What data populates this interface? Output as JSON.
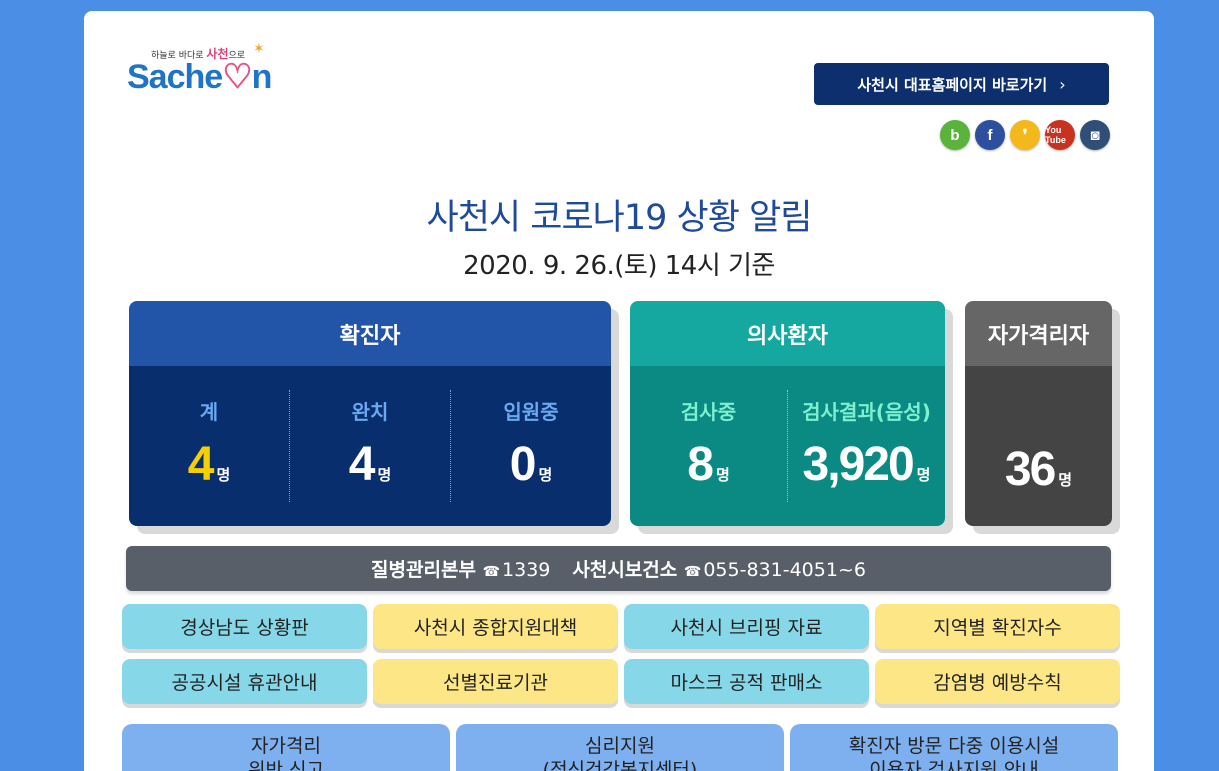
{
  "logo": {
    "tagline_prefix": "하늘로 바다로",
    "tagline_mid": "사천",
    "tagline_suffix": "으로",
    "word_a": "Sache",
    "word_heart": "♡",
    "word_b": "n"
  },
  "header": {
    "home_button": "사천시 대표홈페이지 바로가기",
    "home_chevron": "›"
  },
  "social": [
    {
      "name": "band",
      "glyph": "b"
    },
    {
      "name": "facebook",
      "glyph": "f"
    },
    {
      "name": "kakaostory",
      "glyph": "❜"
    },
    {
      "name": "youtube",
      "glyph": "You Tube"
    },
    {
      "name": "instagram",
      "glyph": "◙"
    }
  ],
  "title": "사천시 코로나19 상황 알림",
  "date": "2020. 9. 26.(토) 14시 기준",
  "confirmed": {
    "header": "확진자",
    "items": [
      {
        "label": "계",
        "value": "4",
        "unit": "명"
      },
      {
        "label": "완치",
        "value": "4",
        "unit": "명"
      },
      {
        "label": "입원중",
        "value": "0",
        "unit": "명"
      }
    ]
  },
  "suspected": {
    "header": "의사환자",
    "items": [
      {
        "label": "검사중",
        "value": "8",
        "unit": "명"
      },
      {
        "label": "검사결과(음성)",
        "value": "3,920",
        "unit": "명"
      }
    ]
  },
  "self_quarantine": {
    "header": "자가격리자",
    "value": "36",
    "unit": "명"
  },
  "phone_bar": {
    "kcdc_label": "질병관리본부",
    "tel_icon": "☎",
    "kcdc_number": "1339",
    "health_label": "사천시보건소",
    "health_number": "055-831-4051~6"
  },
  "links": [
    "경상남도 상황판",
    "사천시 종합지원대책",
    "사천시 브리핑 자료",
    "지역별 확진자수",
    "공공시설 휴관안내",
    "선별진료기관",
    "마스크 공적 판매소",
    "감염병 예방수칙"
  ],
  "big_links": [
    {
      "line1": "자가격리",
      "line2": "위반 신고"
    },
    {
      "line1": "심리지원",
      "line2": "(정신건강복지센터)"
    },
    {
      "line1": "확진자 방문 다중 이용시설",
      "line2": "이용자 검사지원 안내"
    }
  ]
}
